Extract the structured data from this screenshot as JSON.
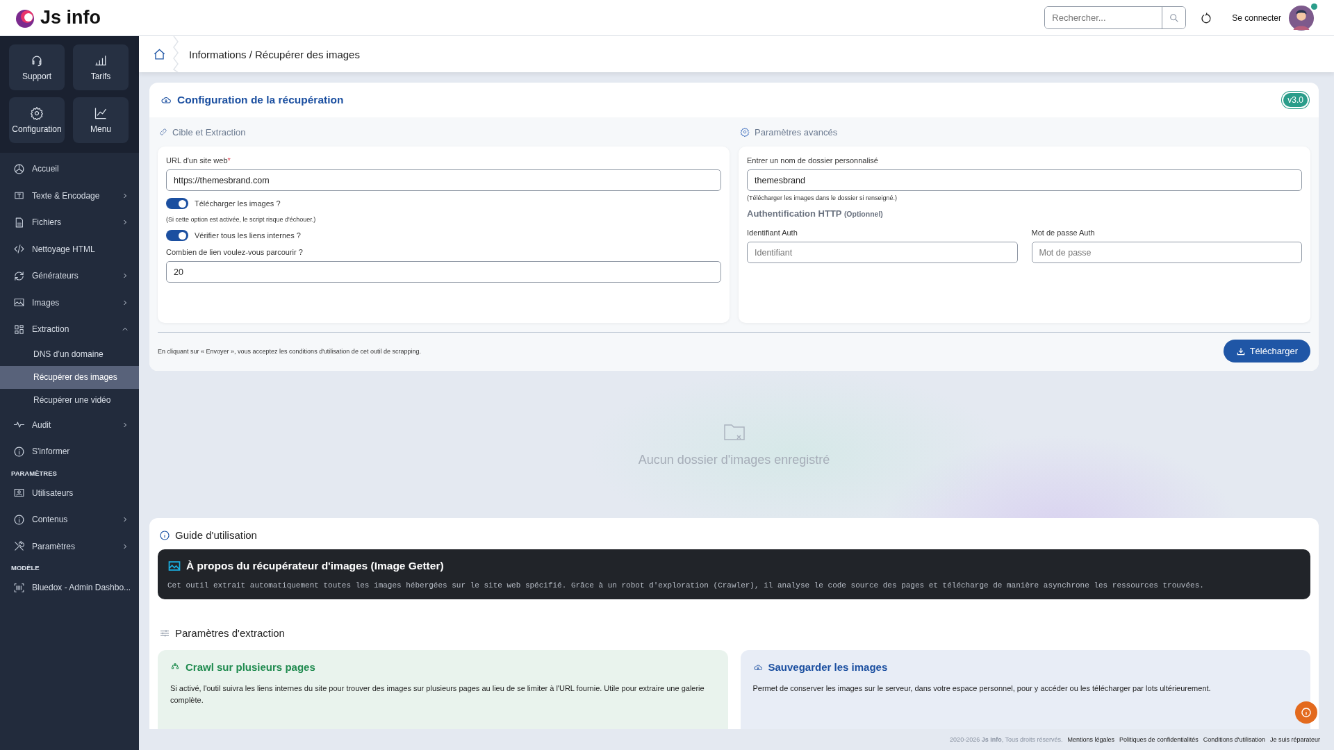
{
  "header": {
    "logo_text": "Js info",
    "search": {
      "placeholder": "Rechercher..."
    },
    "login": "Se connecter",
    "online": true
  },
  "sidebar": {
    "tiles": [
      {
        "label": "Support"
      },
      {
        "label": "Tarifs"
      },
      {
        "label": "Configuration"
      },
      {
        "label": "Menu"
      }
    ],
    "sections": [
      {
        "items": [
          {
            "label": "Accueil",
            "selected": false
          },
          {
            "label": "Texte & Encodage",
            "selected": false,
            "expanded": false
          },
          {
            "label": "Fichiers",
            "selected": false,
            "expanded": false
          },
          {
            "label": "Nettoyage HTML",
            "selected": false
          },
          {
            "label": "Générateurs",
            "selected": false,
            "expanded": false
          },
          {
            "label": "Images",
            "selected": false,
            "expanded": false
          },
          {
            "label": "Extraction",
            "selected": false,
            "expanded": true,
            "children": [
              {
                "label": "DNS d’un domaine",
                "selected": false
              },
              {
                "label": "Récupérer des images",
                "selected": true
              },
              {
                "label": "Récupérer une vidéo",
                "selected": false
              }
            ]
          },
          {
            "label": "Audit",
            "selected": false,
            "expanded": false
          },
          {
            "label": "S'informer",
            "selected": false
          }
        ]
      },
      {
        "heading": "PARAMÈTRES",
        "items": [
          {
            "label": "Utilisateurs",
            "selected": false
          },
          {
            "label": "Contenus",
            "selected": false,
            "expanded": false
          },
          {
            "label": "Paramètres",
            "selected": false,
            "expanded": false
          }
        ]
      },
      {
        "heading": "MODÈLE",
        "items": [
          {
            "label": "Bluedox - Admin Dashbo...",
            "selected": false
          }
        ]
      }
    ]
  },
  "breadcrumb": "Informations / Récupérer des images",
  "config": {
    "title": "Configuration de la récupération",
    "version": "v3.0",
    "left": {
      "heading": "Cible et Extraction",
      "fields": [
        {
          "kind": "input",
          "label": "URL d'un site web",
          "required_mark": "*",
          "value": "https://themesbrand.com"
        },
        {
          "kind": "toggle",
          "label": "Télécharger les images ?",
          "on": true
        },
        {
          "kind": "note",
          "text": "(Si cette option est activée, le script risque d'échouer.)"
        },
        {
          "kind": "toggle",
          "label": "Vérifier tous les liens internes ?",
          "on": true
        },
        {
          "kind": "input",
          "label": "Combien de lien voulez-vous parcourir ?",
          "value": "20"
        }
      ]
    },
    "right": {
      "heading": "Paramètres avancés",
      "folder": {
        "label": "Entrer un nom de dossier personnalisé",
        "value": "themesbrand",
        "note": "(Télécharger les images dans le dossier si renseigné.)"
      },
      "auth": {
        "title": "Authentification HTTP",
        "optional": "(Optionnel)",
        "fields": [
          {
            "label": "Identifiant Auth",
            "placeholder": "Identifiant"
          },
          {
            "label": "Mot de passe Auth",
            "placeholder": "Mot de passe"
          }
        ]
      }
    },
    "terms": "En cliquant sur « Envoyer », vous acceptez les conditions d'utilisation de cet outil de scrapping.",
    "submit": "Télécharger"
  },
  "empty": "Aucun dossier d'images enregistré",
  "guide": {
    "title": "Guide d'utilisation",
    "about": {
      "title": "À propos du récupérateur d'images (Image Getter)",
      "text": "Cet outil extrait automatiquement toutes les images hébergées sur le site web spécifié. Grâce à un robot d'exploration (Crawler), il analyse le code source des pages et télécharge de manière asynchrone les ressources trouvées."
    },
    "params_title": "Paramètres d'extraction",
    "cards": [
      {
        "title": "Crawl sur plusieurs pages",
        "text": "Si activé, l'outil suivra les liens internes du site pour trouver des images sur plusieurs pages au lieu de se limiter à l'URL fournie. Utile pour extraire une galerie complète.",
        "color": "#1e8a4e"
      },
      {
        "title": "Sauvegarder les images",
        "text": "Permet de conserver les images sur le serveur, dans votre espace personnel, pour y accéder ou les télécharger par lots ultérieurement.",
        "color": "#1b4fa0"
      }
    ]
  },
  "footer": {
    "copyright": "2020-2026 **Js Info**, Tous droits réservés.",
    "links": [
      "Mentions légales",
      "Politiques de confidentialités",
      "Conditions d'utilisation",
      "Je suis réparateur"
    ]
  }
}
